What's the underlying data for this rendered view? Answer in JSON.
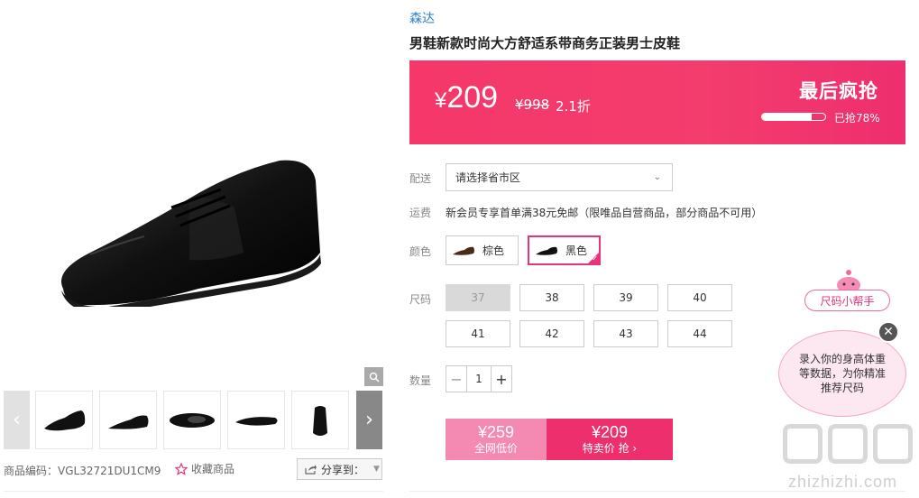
{
  "gallery": {
    "thumb_prev_icon": "chevron-left",
    "thumb_next_icon": "chevron-right",
    "zoom_icon": "magnifier",
    "sku_text": "商品编码：VGL32721DU1CM9",
    "favorite_label": "收藏商品",
    "share_label": "分享到："
  },
  "product": {
    "brand": "森达",
    "title": "男鞋新款时尚大方舒适系带商务正装男士皮鞋"
  },
  "price": {
    "currency": "¥",
    "current": "209",
    "original": "¥998",
    "discount": "2.1折",
    "rush_title": "最后疯抢",
    "rush_percent": 0.78,
    "rush_text": "已抢78%"
  },
  "delivery": {
    "label": "配送",
    "select_value": "请选择省市区"
  },
  "shipping": {
    "label": "运费",
    "text": "新会员专享首单满38元免邮（限唯品自营商品，部分商品不可用）"
  },
  "colors": {
    "label": "颜色",
    "options": [
      {
        "label": "棕色",
        "selected": false
      },
      {
        "label": "黑色",
        "selected": true
      }
    ]
  },
  "sizes": {
    "label": "尺码",
    "options": [
      "37",
      "38",
      "39",
      "40",
      "41",
      "42",
      "43",
      "44"
    ],
    "disabled": [
      "37"
    ]
  },
  "quantity": {
    "label": "数量",
    "value": "1",
    "minus": "−",
    "plus": "+"
  },
  "buy": {
    "group_price": "¥259",
    "group_label": "全网低价",
    "special_price": "¥209",
    "special_label": "特卖价 抢 ›"
  },
  "size_helper": {
    "pill_label": "尺码小帮手",
    "bubble_text": "录入你的身高体重等数据，为你精准推荐尺码",
    "close_icon": "close"
  },
  "watermark": {
    "url": "zhizhizhi.com"
  },
  "colors_theme": {
    "accent": "#ee2f6e",
    "brand_link": "#2e7fc9"
  }
}
